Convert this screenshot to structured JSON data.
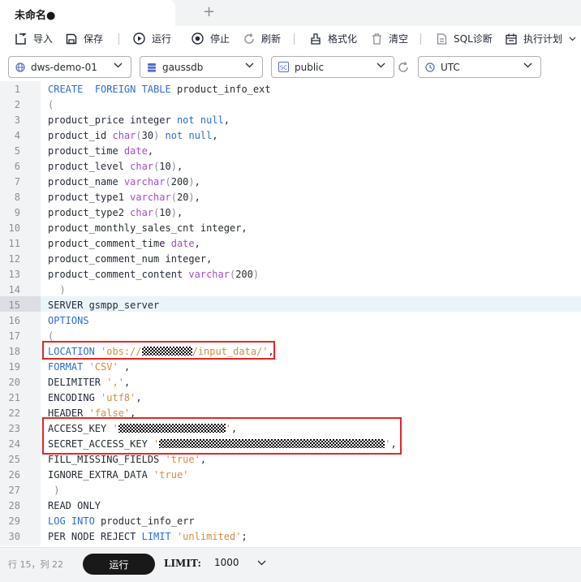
{
  "tab": {
    "title": "未命名●"
  },
  "toolbar": {
    "import_label": "导入",
    "save_label": "保存",
    "run_label": "运行",
    "stop_label": "停止",
    "refresh_label": "刷新",
    "format_label": "格式化",
    "clear_label": "清空",
    "sql_diag_label": "SQL诊断",
    "plan_label": "执行计划"
  },
  "selects": {
    "cluster": "dws-demo-01",
    "database": "gaussdb",
    "schema": "public",
    "timezone": "UTC"
  },
  "editor": {
    "current_line": 15,
    "lines": [
      {
        "n": "1",
        "t": [
          [
            "kw",
            "CREATE"
          ],
          [
            "",
            "  "
          ],
          [
            "kw",
            "FOREIGN"
          ],
          [
            "",
            ""
          ],
          [
            "kw",
            " TABLE"
          ],
          [
            "",
            " product_info_ext"
          ]
        ]
      },
      {
        "n": "2",
        "t": [
          [
            "pun",
            "("
          ]
        ]
      },
      {
        "n": "3",
        "t": [
          [
            "",
            "product_price integer "
          ],
          [
            "kw",
            "not"
          ],
          [
            "",
            " "
          ],
          [
            "kw",
            "null"
          ],
          [
            "",
            ","
          ]
        ]
      },
      {
        "n": "4",
        "t": [
          [
            "",
            "product_id "
          ],
          [
            "ty",
            "char"
          ],
          [
            "pun",
            "("
          ],
          [
            "",
            "30"
          ],
          [
            "pun",
            ")"
          ],
          [
            "",
            " "
          ],
          [
            "kw",
            "not"
          ],
          [
            "",
            " "
          ],
          [
            "kw",
            "null"
          ],
          [
            "",
            ","
          ]
        ]
      },
      {
        "n": "5",
        "t": [
          [
            "",
            "product_time "
          ],
          [
            "ty",
            "date"
          ],
          [
            "",
            ","
          ]
        ]
      },
      {
        "n": "6",
        "t": [
          [
            "",
            "product_level "
          ],
          [
            "ty",
            "char"
          ],
          [
            "pun",
            "("
          ],
          [
            "",
            "10"
          ],
          [
            "pun",
            ")"
          ],
          [
            "",
            ","
          ]
        ]
      },
      {
        "n": "7",
        "t": [
          [
            "",
            "product_name "
          ],
          [
            "ty",
            "varchar"
          ],
          [
            "pun",
            "("
          ],
          [
            "",
            "200"
          ],
          [
            "pun",
            ")"
          ],
          [
            "",
            ","
          ]
        ]
      },
      {
        "n": "8",
        "t": [
          [
            "",
            "product_type1 "
          ],
          [
            "ty",
            "varchar"
          ],
          [
            "pun",
            "("
          ],
          [
            "",
            "20"
          ],
          [
            "pun",
            ")"
          ],
          [
            "",
            ","
          ]
        ]
      },
      {
        "n": "9",
        "t": [
          [
            "",
            "product_type2 "
          ],
          [
            "ty",
            "char"
          ],
          [
            "pun",
            "("
          ],
          [
            "",
            "10"
          ],
          [
            "pun",
            ")"
          ],
          [
            "",
            ","
          ]
        ]
      },
      {
        "n": "10",
        "t": [
          [
            "",
            "product_monthly_sales_cnt integer,"
          ]
        ]
      },
      {
        "n": "11",
        "t": [
          [
            "",
            "product_comment_time "
          ],
          [
            "ty",
            "date"
          ],
          [
            "",
            ","
          ]
        ]
      },
      {
        "n": "12",
        "t": [
          [
            "",
            "product_comment_num integer,"
          ]
        ]
      },
      {
        "n": "13",
        "t": [
          [
            "",
            "product_comment_content "
          ],
          [
            "ty",
            "varchar"
          ],
          [
            "pun",
            "("
          ],
          [
            "",
            "200"
          ],
          [
            "pun",
            ")"
          ]
        ]
      },
      {
        "n": "14",
        "t": [
          [
            "pun",
            "  )"
          ]
        ]
      },
      {
        "n": "15",
        "t": [
          [
            "",
            "SERVER gsmpp_server"
          ]
        ]
      },
      {
        "n": "16",
        "t": [
          [
            "kw",
            "OPTIONS"
          ]
        ]
      },
      {
        "n": "17",
        "t": [
          [
            "pun",
            "("
          ]
        ]
      },
      {
        "n": "18",
        "t": [
          [
            "kw",
            "LOCATION"
          ],
          [
            "",
            " "
          ],
          [
            "str",
            "'obs://"
          ],
          [
            "mask",
            "62"
          ],
          [
            "str",
            "/input_data/'"
          ],
          [
            "",
            ","
          ]
        ]
      },
      {
        "n": "19",
        "t": [
          [
            "kw",
            "FORMAT"
          ],
          [
            "",
            " "
          ],
          [
            "str",
            "'CSV'"
          ],
          [
            "",
            " ,"
          ]
        ]
      },
      {
        "n": "20",
        "t": [
          [
            "",
            "DELIMITER "
          ],
          [
            "str",
            "','"
          ],
          [
            "",
            ","
          ]
        ]
      },
      {
        "n": "21",
        "t": [
          [
            "",
            "ENCODING "
          ],
          [
            "str",
            "'utf8'"
          ],
          [
            "",
            ","
          ]
        ]
      },
      {
        "n": "22",
        "t": [
          [
            "",
            "HEADER "
          ],
          [
            "str",
            "'false'"
          ],
          [
            "",
            ","
          ]
        ]
      },
      {
        "n": "23",
        "t": [
          [
            "",
            "ACCESS_KEY "
          ],
          [
            "str",
            "'"
          ],
          [
            "mask",
            "132"
          ],
          [
            "str",
            "'"
          ],
          [
            "",
            ","
          ]
        ]
      },
      {
        "n": "24",
        "t": [
          [
            "",
            "SECRET_ACCESS_KEY "
          ],
          [
            "str",
            "'"
          ],
          [
            "mask",
            "278"
          ],
          [
            "str",
            "'"
          ],
          [
            "",
            ","
          ]
        ]
      },
      {
        "n": "25",
        "t": [
          [
            "",
            "FILL_MISSING_FIELDS "
          ],
          [
            "str",
            "'true'"
          ],
          [
            "",
            ","
          ]
        ]
      },
      {
        "n": "26",
        "t": [
          [
            "",
            "IGNORE_EXTRA_DATA "
          ],
          [
            "str",
            "'true'"
          ]
        ]
      },
      {
        "n": "27",
        "t": [
          [
            "pun",
            " )"
          ]
        ]
      },
      {
        "n": "28",
        "t": [
          [
            "",
            "READ ONLY"
          ]
        ]
      },
      {
        "n": "29",
        "t": [
          [
            "kw",
            "LOG"
          ],
          [
            "",
            " "
          ],
          [
            "kw",
            "INTO"
          ],
          [
            "",
            " product_info_err"
          ]
        ]
      },
      {
        "n": "30",
        "t": [
          [
            "",
            "PER NODE REJECT "
          ],
          [
            "kw",
            "LIMIT"
          ],
          [
            "",
            " "
          ],
          [
            "str",
            "'unlimited'"
          ],
          [
            "",
            ";"
          ]
        ]
      }
    ]
  },
  "status": {
    "position": "行 15，列 22",
    "run_button": "运行",
    "limit_label": "LIMIT:",
    "limit_value": "1000"
  }
}
